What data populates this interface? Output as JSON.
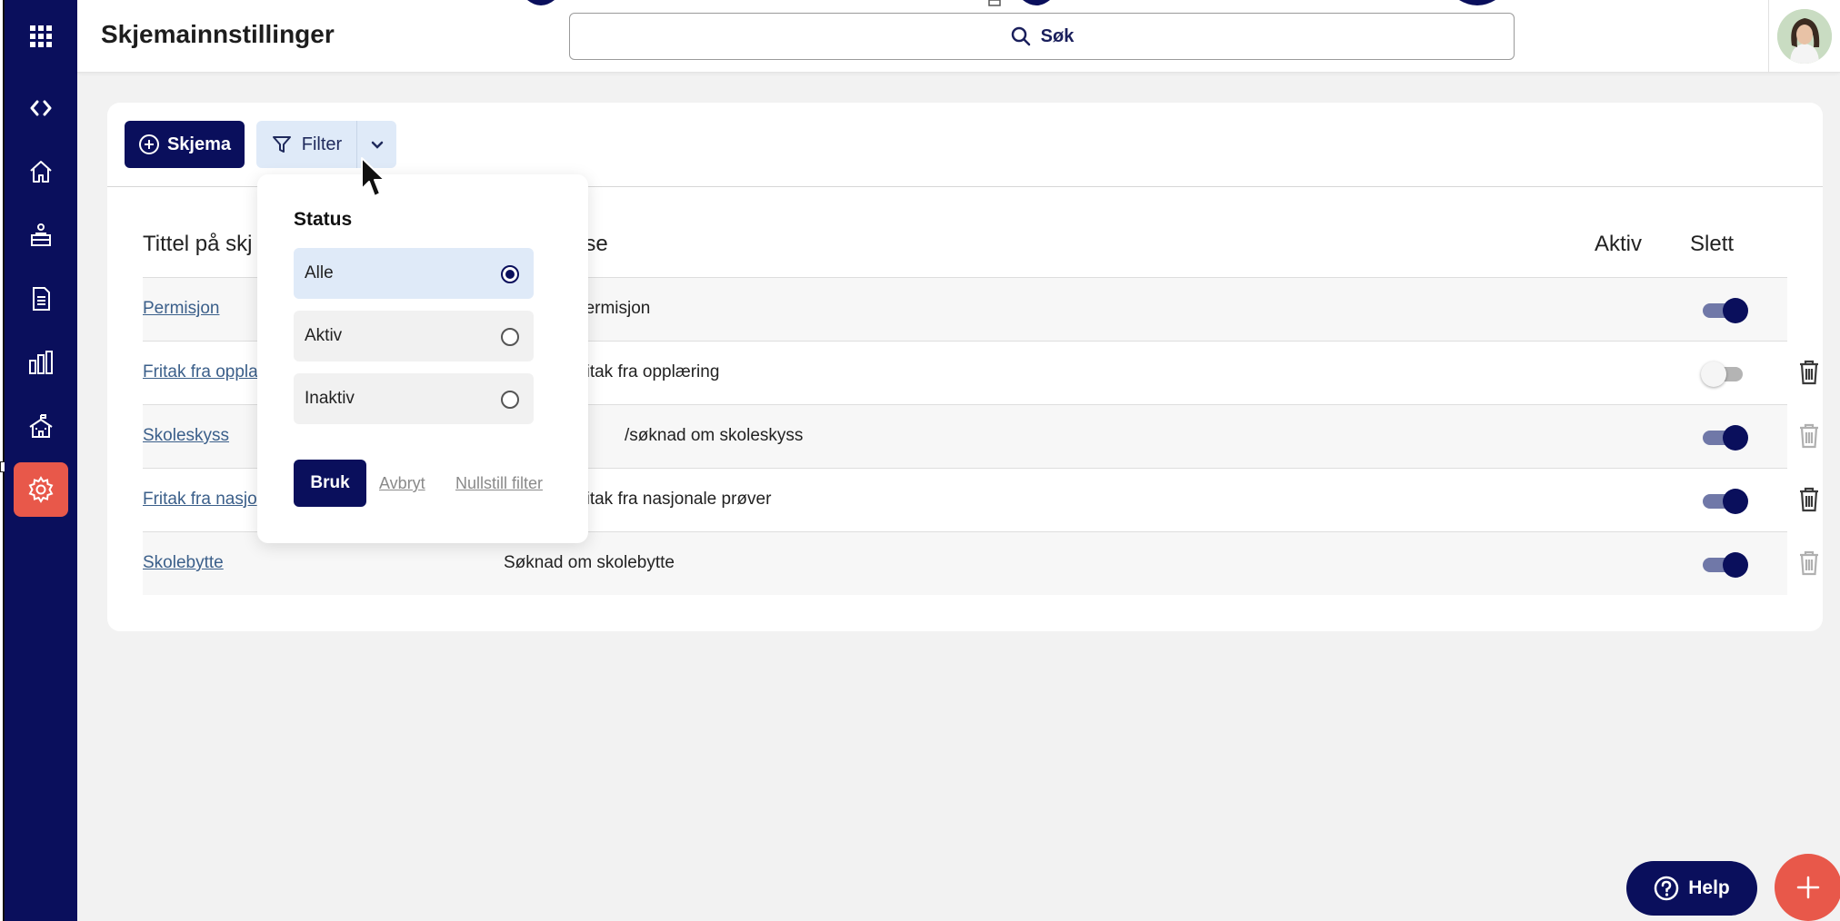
{
  "header": {
    "title": "Skjemainnstillinger",
    "search_label": "Søk"
  },
  "sidebar": {
    "items": [
      {
        "name": "apps",
        "icon": "grid-icon"
      },
      {
        "name": "collapse",
        "icon": "code-arrows-icon"
      },
      {
        "name": "home",
        "icon": "home-icon"
      },
      {
        "name": "inbox",
        "icon": "tray-icon"
      },
      {
        "name": "documents",
        "icon": "document-icon"
      },
      {
        "name": "statistics",
        "icon": "bar-chart-icon"
      },
      {
        "name": "school",
        "icon": "school-icon"
      },
      {
        "name": "settings",
        "icon": "gear-icon",
        "active": true
      }
    ]
  },
  "toolbar": {
    "add_label": "Skjema",
    "filter_label": "Filter"
  },
  "table": {
    "columns": {
      "title": "Tittel på skj",
      "description": "lse",
      "active": "Aktiv",
      "delete": "Slett"
    },
    "rows": [
      {
        "title": "Permisjon",
        "description": "permisjon",
        "active": true,
        "deletable": false
      },
      {
        "title": "Fritak fra oppla",
        "description": "fritak fra opplæring",
        "active": false,
        "deletable": true
      },
      {
        "title": "Skoleskyss",
        "description": "/søknad om skoleskyss",
        "active": true,
        "deletable": true,
        "delete_disabled": true
      },
      {
        "title": "Fritak fra nasjo",
        "description": "fritak fra nasjonale prøver",
        "active": true,
        "deletable": true
      },
      {
        "title": "Skolebytte",
        "description": "Søknad om skolebytte",
        "active": true,
        "deletable": true,
        "delete_disabled": true
      }
    ]
  },
  "filter_dropdown": {
    "heading": "Status",
    "options": [
      {
        "label": "Alle",
        "selected": true
      },
      {
        "label": "Aktiv",
        "selected": false
      },
      {
        "label": "Inaktiv",
        "selected": false
      }
    ],
    "apply_label": "Bruk",
    "cancel_label": "Avbryt",
    "reset_label": "Nullstill filter"
  },
  "help": {
    "label": "Help"
  },
  "colors": {
    "navy": "#0a0f5c",
    "accent": "#e8584a",
    "link": "#3b5f8a",
    "filter_bg": "#dfeaf8"
  }
}
